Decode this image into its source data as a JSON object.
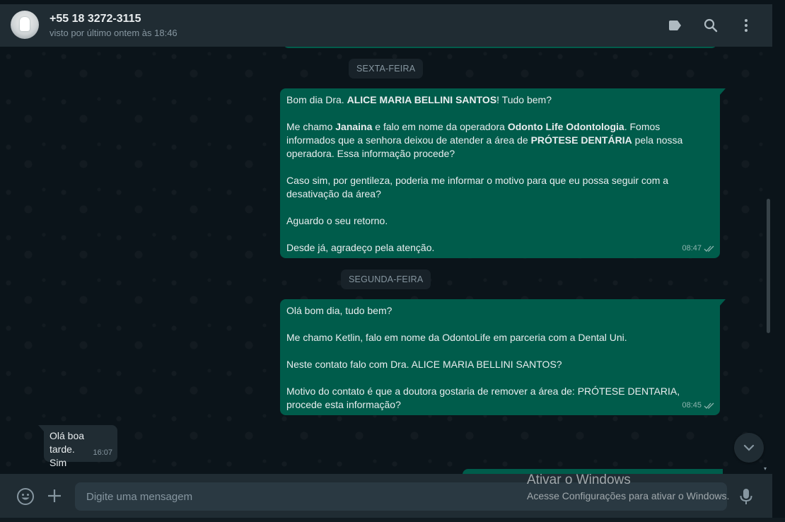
{
  "header": {
    "contact_name": "+55 18 3272-3115",
    "status": "visto por último ontem às 18:46",
    "icons": [
      "label-icon",
      "search-icon",
      "menu-icon"
    ]
  },
  "chat": {
    "date_separators": [
      "SEXTA-FEIRA",
      "SEGUNDA-FEIRA"
    ],
    "messages": [
      {
        "direction": "outgoing",
        "time": "08:47",
        "status": "double-check",
        "lines": {
          "l1_a": "Bom dia Dra. ",
          "l1_b": "ALICE MARIA BELLINI SANTOS",
          "l1_c": "! Tudo bem?",
          "l2_a": "Me chamo ",
          "l2_b": "Janaina",
          "l2_c": " e falo em nome da operadora ",
          "l2_d": "Odonto Life Odontologia",
          "l2_e": ". Fomos informados que a senhora deixou de atender a área de ",
          "l2_f": "PRÓTESE DENTÁRIA",
          "l2_g": " pela nossa operadora. Essa informação procede?",
          "l3": "Caso sim, por gentileza, poderia me informar o motivo para que eu possa seguir com a desativação da área?",
          "l4": "Aguardo o seu retorno.",
          "l5": "Desde já, agradeço pela atenção."
        }
      },
      {
        "direction": "outgoing",
        "time": "08:45",
        "status": "double-check",
        "lines": {
          "l1": "Olá bom dia, tudo bem?",
          "l2": "Me chamo Ketlin, falo em nome da OdontoLife em parceria com a Dental Uni.",
          "l3": "Neste contato falo com Dra. ALICE MARIA BELLINI SANTOS?",
          "l4": "Motivo do contato é que a doutora gostaria de remover a área de: PRÓTESE DENTARIA, procede esta informação?"
        }
      },
      {
        "direction": "incoming",
        "time": "16:07",
        "lines": {
          "l1": "Olá boa tarde.",
          "l2": "Sim"
        }
      }
    ]
  },
  "footer": {
    "input_placeholder": "Digite uma mensagem",
    "icons": [
      "emoji-icon",
      "plus-icon",
      "mic-icon"
    ]
  },
  "watermark": {
    "title": "Ativar o Windows",
    "subtitle": "Acesse Configurações para ativar o Windows."
  },
  "colors": {
    "outgoing_bubble": "#005c4b",
    "incoming_bubble": "#202c33",
    "header_bg": "#202c33",
    "chat_bg": "#0b141a"
  }
}
